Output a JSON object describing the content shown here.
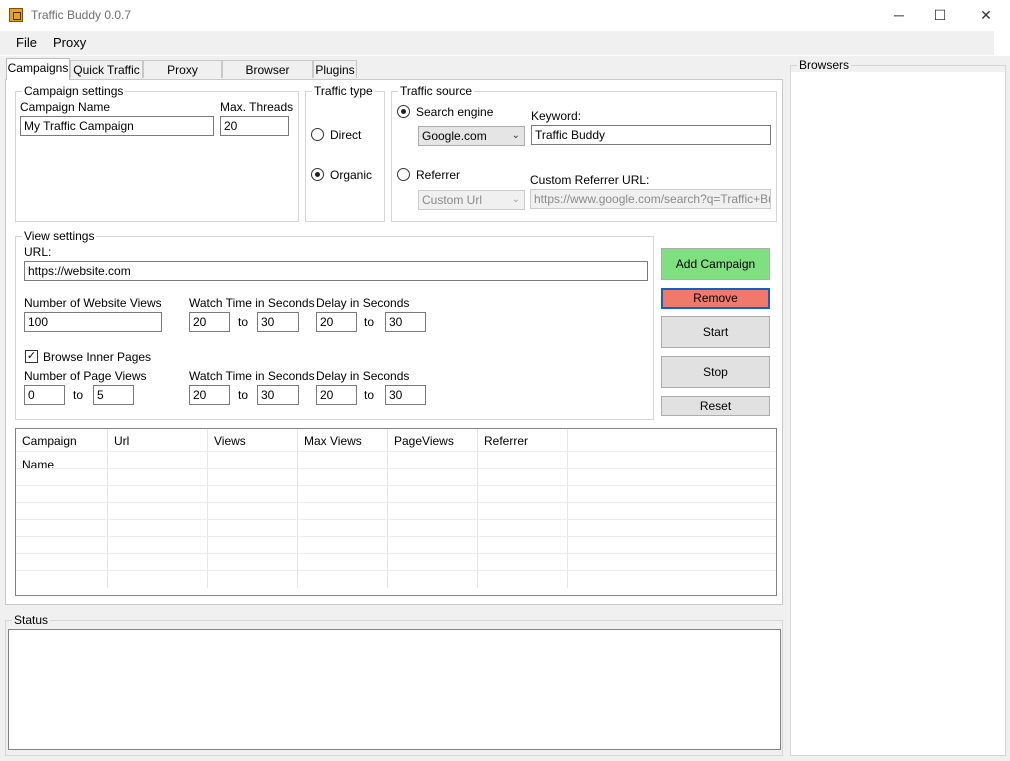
{
  "window": {
    "title": "Traffic Buddy 0.0.7",
    "minimize": "─",
    "maximize": "☐",
    "close": "✕"
  },
  "menu": {
    "file": "File",
    "proxy": "Proxy"
  },
  "tabs": [
    "Campaigns",
    "Quick Traffic",
    "Proxy Settings",
    "Browser Settings",
    "Plugins"
  ],
  "campaign_settings": {
    "title": "Campaign settings",
    "name_label": "Campaign Name",
    "name_value": "My Traffic Campaign",
    "threads_label": "Max. Threads",
    "threads_value": "20"
  },
  "traffic_type": {
    "title": "Traffic type",
    "direct": "Direct",
    "organic": "Organic",
    "selected": "organic"
  },
  "traffic_source": {
    "title": "Traffic source",
    "search_engine": "Search engine",
    "search_engine_value": "Google.com",
    "keyword_label": "Keyword:",
    "keyword_value": "Traffic Buddy",
    "referrer": "Referrer",
    "referrer_value": "Custom Url",
    "custom_referrer_label": "Custom Referrer URL:",
    "custom_referrer_placeholder": "https://www.google.com/search?q=Traffic+Buddy"
  },
  "view_settings": {
    "title": "View settings",
    "url_label": "URL:",
    "url_value": "https://website.com",
    "website_views_label": "Number of Website Views",
    "website_views_value": "100",
    "watch_time_label": "Watch Time in Seconds",
    "watch_min": "20",
    "watch_max": "30",
    "delay_label": "Delay in Seconds",
    "delay_min": "20",
    "delay_max": "30",
    "to": "to",
    "browse_inner": "Browse Inner Pages",
    "browse_inner_checked": true,
    "page_views_label": "Number of Page Views",
    "page_views_min": "0",
    "page_views_max": "5",
    "inner_watch_label": "Watch Time in Seconds",
    "inner_watch_min": "20",
    "inner_watch_max": "30",
    "inner_delay_label": "Delay in Seconds",
    "inner_delay_min": "20",
    "inner_delay_max": "30"
  },
  "actions": {
    "add": "Add Campaign",
    "remove": "Remove",
    "start": "Start",
    "stop": "Stop",
    "reset": "Reset",
    "add_color": "#7ee07e",
    "remove_color": "#f07a6a"
  },
  "grid": {
    "columns": [
      "Campaign Name",
      "Url",
      "Views",
      "Max Views",
      "PageViews",
      "Referrer"
    ]
  },
  "status": {
    "title": "Status"
  },
  "browsers": {
    "title": "Browsers"
  }
}
